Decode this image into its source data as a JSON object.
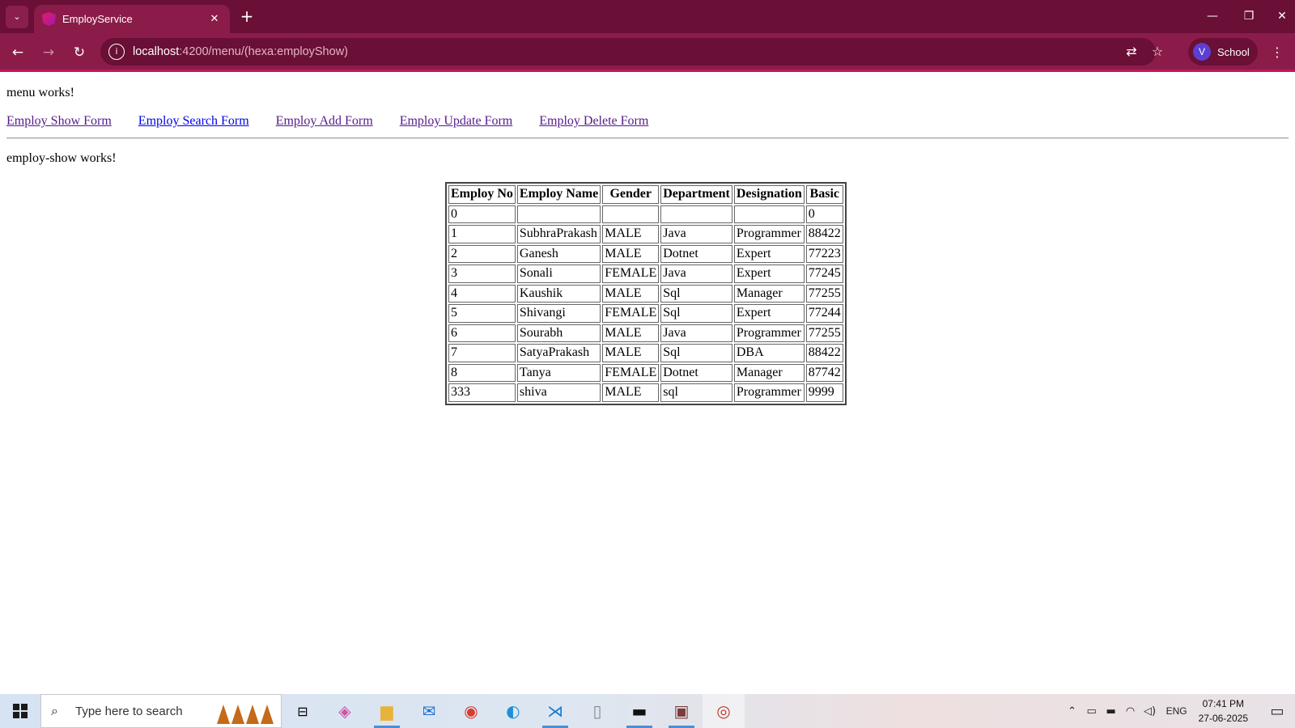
{
  "browser": {
    "tab_title": "EmployService",
    "url_host": "localhost",
    "url_path": ":4200/menu/(hexa:employShow)",
    "profile_initial": "V",
    "profile_name": "School"
  },
  "page": {
    "menu_works": "menu works!",
    "nav_links": [
      {
        "label": "Employ Show Form",
        "visited": true
      },
      {
        "label": "Employ Search Form",
        "visited": false
      },
      {
        "label": "Employ Add Form",
        "visited": true
      },
      {
        "label": "Employ Update Form",
        "visited": true
      },
      {
        "label": "Employ Delete Form",
        "visited": true
      }
    ],
    "show_works": "employ-show works!"
  },
  "table": {
    "headers": [
      "Employ No",
      "Employ Name",
      "Gender",
      "Department",
      "Designation",
      "Basic"
    ],
    "rows": [
      [
        "0",
        "",
        "",
        "",
        "",
        "0"
      ],
      [
        "1",
        "SubhraPrakash",
        "MALE",
        "Java",
        "Programmer",
        "88422"
      ],
      [
        "2",
        "Ganesh",
        "MALE",
        "Dotnet",
        "Expert",
        "77223"
      ],
      [
        "3",
        "Sonali",
        "FEMALE",
        "Java",
        "Expert",
        "77245"
      ],
      [
        "4",
        "Kaushik",
        "MALE",
        "Sql",
        "Manager",
        "77255"
      ],
      [
        "5",
        "Shivangi",
        "FEMALE",
        "Sql",
        "Expert",
        "77244"
      ],
      [
        "6",
        "Sourabh",
        "MALE",
        "Java",
        "Programmer",
        "77255"
      ],
      [
        "7",
        "SatyaPrakash",
        "MALE",
        "Sql",
        "DBA",
        "88422"
      ],
      [
        "8",
        "Tanya",
        "FEMALE",
        "Dotnet",
        "Manager",
        "87742"
      ],
      [
        "333",
        "shiva",
        "MALE",
        "sql",
        "Programmer",
        "9999"
      ]
    ]
  },
  "taskbar": {
    "search_placeholder": "Type here to search",
    "language": "ENG",
    "time": "07:41 PM",
    "date": "27-06-2025"
  },
  "colors": {
    "tab_strip": "#6a0f36",
    "toolbar": "#8b1c49",
    "visited_link": "#551a8b",
    "unvisited_link": "#0000ee"
  }
}
